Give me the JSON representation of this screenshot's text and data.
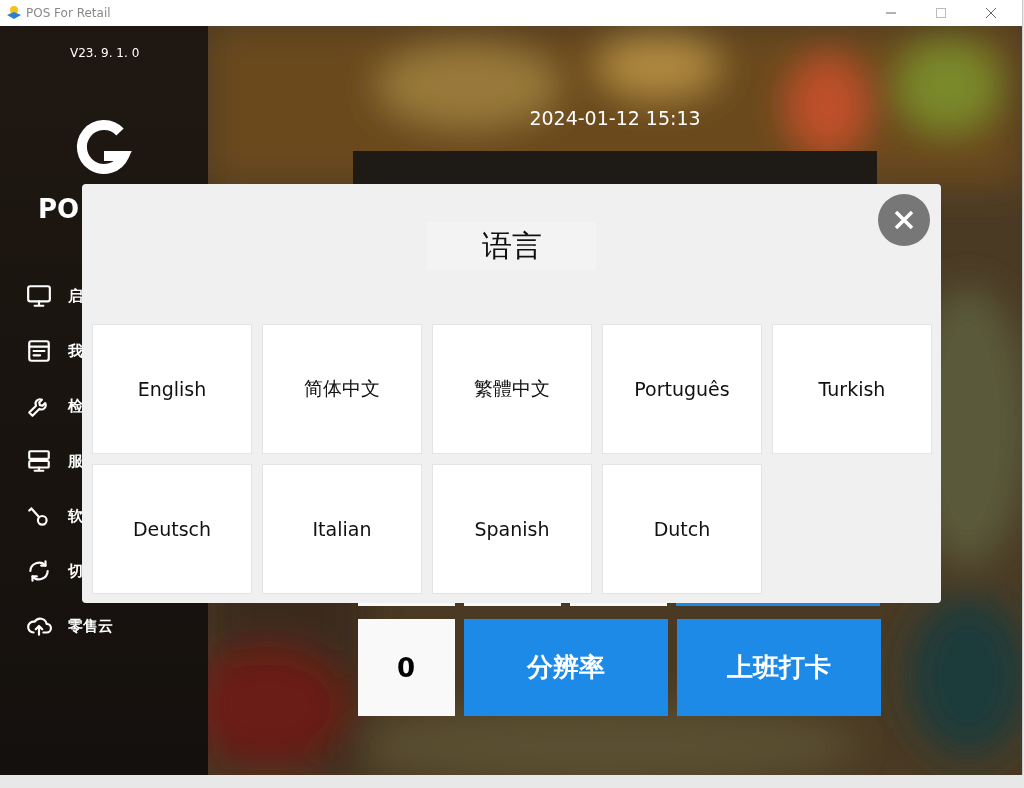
{
  "window": {
    "title": "POS For Retail"
  },
  "sidebar": {
    "version": "V23. 9. 1. 0",
    "brand": "PO",
    "items": [
      {
        "kind": "monitor",
        "label": "启"
      },
      {
        "kind": "form",
        "label": "我"
      },
      {
        "kind": "wrench",
        "label": "检"
      },
      {
        "kind": "server",
        "label": "服"
      },
      {
        "kind": "key",
        "label": "软"
      },
      {
        "kind": "refresh",
        "label": "切"
      },
      {
        "kind": "cloud",
        "label": "零售云"
      }
    ]
  },
  "main": {
    "datetime": "2024-01-12 15:13",
    "keypad": [
      [
        {
          "kind": "digit"
        },
        {
          "kind": "digit"
        },
        {
          "kind": "digit"
        },
        {
          "kind": "action"
        }
      ],
      [
        {
          "kind": "digit",
          "label": "0"
        },
        {
          "kind": "action",
          "label": "分辨率"
        },
        {
          "kind": "action",
          "label": "上班打卡"
        }
      ]
    ]
  },
  "language_dialog": {
    "title": "语言",
    "languages": [
      "English",
      "简体中文",
      "繁體中文",
      "Português",
      "Turkish",
      "Deutsch",
      "Italian",
      "Spanish",
      "Dutch"
    ]
  }
}
